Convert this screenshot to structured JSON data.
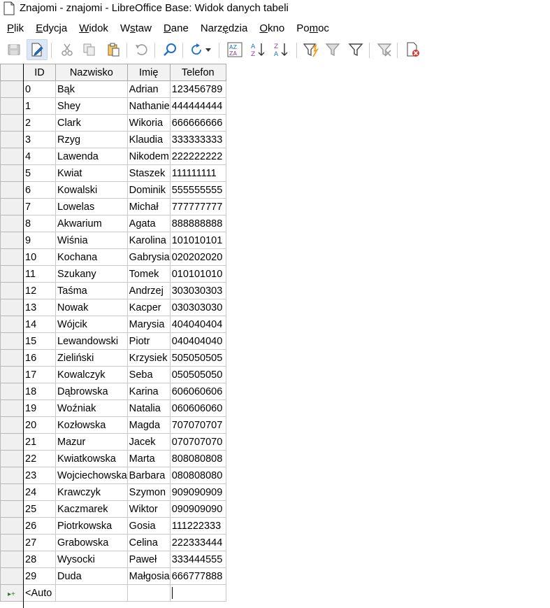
{
  "window": {
    "title": "Znajomi - znajomi - LibreOffice Base: Widok danych tabeli"
  },
  "menu": {
    "items": [
      {
        "accel": "P",
        "rest": "lik"
      },
      {
        "accel": "E",
        "rest": "dycja"
      },
      {
        "accel": "W",
        "rest": "idok"
      },
      {
        "pre": "W",
        "accel": "s",
        "rest": "taw"
      },
      {
        "accel": "D",
        "rest": "ane"
      },
      {
        "pre": "Narz",
        "accel": "ę",
        "rest": "dzia"
      },
      {
        "accel": "O",
        "rest": "kno"
      },
      {
        "pre": "Po",
        "accel": "m",
        "rest": "oc"
      }
    ]
  },
  "toolbar": {
    "icons": [
      "save-record-icon",
      "edit-data-icon",
      "cut-icon",
      "copy-icon",
      "paste-icon",
      "undo-icon",
      "find-record-icon",
      "refresh-icon",
      "sort-icon",
      "sort-ascending-icon",
      "sort-descending-icon",
      "autofilter-icon",
      "apply-filter-icon",
      "standard-filter-icon",
      "reset-filter-icon",
      "delete-record-icon"
    ]
  },
  "table": {
    "columns": [
      "ID",
      "Nazwisko",
      "Imię",
      "Telefon"
    ],
    "rows": [
      [
        "0",
        "Bąk",
        "Adrian",
        "123456789"
      ],
      [
        "1",
        "Shey",
        "Nathanie",
        "444444444"
      ],
      [
        "2",
        "Clark",
        "Wikoria",
        "666666666"
      ],
      [
        "3",
        "Rzyg",
        "Klaudia",
        "333333333"
      ],
      [
        "4",
        "Lawenda",
        "Nikodem",
        "222222222"
      ],
      [
        "5",
        "Kwiat",
        "Staszek",
        "111111111"
      ],
      [
        "6",
        "Kowalski",
        "Dominik",
        "555555555"
      ],
      [
        "7",
        "Lowelas",
        "Michał",
        "777777777"
      ],
      [
        "8",
        "Akwarium",
        "Agata",
        "888888888"
      ],
      [
        "9",
        "Wiśnia",
        "Karolina",
        "101010101"
      ],
      [
        "10",
        "Kochana",
        "Gabrysia",
        "020202020"
      ],
      [
        "11",
        "Szukany",
        "Tomek",
        "010101010"
      ],
      [
        "12",
        "Taśma",
        "Andrzej",
        "303030303"
      ],
      [
        "13",
        "Nowak",
        "Kacper",
        "030303030"
      ],
      [
        "14",
        "Wójcik",
        "Marysia",
        "404040404"
      ],
      [
        "15",
        "Lewandowski",
        "Piotr",
        "040404040"
      ],
      [
        "16",
        "Zieliński",
        "Krzysiek",
        "505050505"
      ],
      [
        "17",
        "Kowalczyk",
        "Seba",
        "050505050"
      ],
      [
        "18",
        "Dąbrowska",
        "Karina",
        "606060606"
      ],
      [
        "19",
        "Woźniak",
        "Natalia",
        "060606060"
      ],
      [
        "20",
        "Kozłowska",
        "Magda",
        "707070707"
      ],
      [
        "21",
        "Mazur",
        "Jacek",
        "070707070"
      ],
      [
        "22",
        "Kwiatkowska",
        "Marta",
        "808080808"
      ],
      [
        "23",
        "Wojciechowska",
        "Barbara",
        "080808080"
      ],
      [
        "24",
        "Krawczyk",
        "Szymon",
        "909090909"
      ],
      [
        "25",
        "Kaczmarek",
        "Wiktor",
        "090909090"
      ],
      [
        "26",
        "Piotrkowska",
        "Gosia",
        "111222333"
      ],
      [
        "27",
        "Grabowska",
        "Celina",
        "222333444"
      ],
      [
        "28",
        "Wysocki",
        "Paweł",
        "333444555"
      ],
      [
        "29",
        "Duda",
        "Małgosia",
        "666777888"
      ]
    ],
    "new_row_id": "<Auto",
    "new_row_marker": "▸+"
  }
}
